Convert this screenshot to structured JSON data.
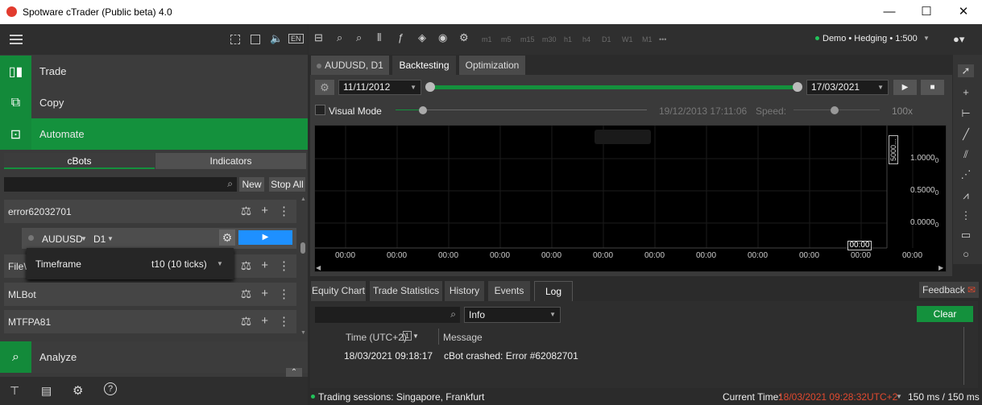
{
  "app": {
    "title": "Spotware cTrader (Public beta) 4.0"
  },
  "window": {
    "minimize": "—",
    "maximize": "☐",
    "close": "✕"
  },
  "left": {
    "lang": "EN",
    "nav": [
      {
        "label": "Trade"
      },
      {
        "label": "Copy"
      },
      {
        "label": "Automate"
      },
      {
        "label": "Analyze"
      }
    ],
    "tabs": {
      "cbots": "cBots",
      "indicators": "Indicators"
    },
    "new_label": "New",
    "stopall_label": "Stop All",
    "bots": [
      {
        "name": "error62032701"
      },
      {
        "name": "FileW"
      },
      {
        "name": "MLBot"
      },
      {
        "name": "MTFPA81"
      }
    ],
    "instance": {
      "symbol": "AUDUSD",
      "timeframe": "D1"
    },
    "popup": {
      "label": "Timeframe",
      "value": "t10 (10 ticks)"
    }
  },
  "toolbar": {
    "timeframes": [
      "m1",
      "m5",
      "m15",
      "m30",
      "h1",
      "h4",
      "D1",
      "W1",
      "M1"
    ],
    "more": "•••",
    "account": "Demo • Hedging • 1:500"
  },
  "tabs": {
    "instrument": "AUDUSD, D1",
    "backtesting": "Backtesting",
    "optimization": "Optimization"
  },
  "backtest": {
    "start_date": "11/11/2012",
    "end_date": "17/03/2021",
    "visual_mode": "Visual Mode",
    "current_time": "19/12/2013 17:11:06",
    "speed_label": "Speed:",
    "speed_value": "100x"
  },
  "chart": {
    "y_labels": [
      "1.0000",
      "0.5000",
      "0.0000"
    ],
    "y_sub": "0",
    "scale_box": "5000...",
    "x_labels": [
      "00:00",
      "00:00",
      "00:00",
      "00:00",
      "00:00",
      "00:00",
      "00:00",
      "00:00",
      "00:00",
      "00:00",
      "00:00",
      "00:00"
    ],
    "cursor_label": "00:00"
  },
  "bottom_tabs": [
    "Equity Chart",
    "Trade Statistics",
    "History",
    "Events",
    "Log"
  ],
  "feedback": "Feedback",
  "log": {
    "filter": "Info",
    "clear": "Clear",
    "col_time": "Time (UTC+2)",
    "col_msg": "Message",
    "rows": [
      {
        "time": "18/03/2021 09:18:17",
        "msg": "cBot crashed: Error #62082701"
      }
    ]
  },
  "status": {
    "sessions": "Trading sessions: Singapore, Frankfurt",
    "current_label": "Current Time:",
    "current_time": "18/03/2021 09:28:32",
    "tz": "UTC+2",
    "latency": "150 ms / 150 ms"
  },
  "colors": {
    "accent": "#14913d",
    "error": "#e0492f",
    "play": "#1e90ff"
  }
}
